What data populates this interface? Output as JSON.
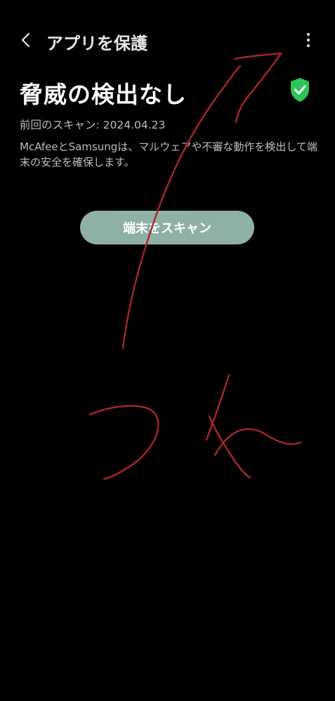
{
  "header": {
    "title": "アプリを保護",
    "back_icon": "chevron-left-icon",
    "more_icon": "more-vertical-icon"
  },
  "status": {
    "title": "脅威の検出なし",
    "icon": "shield-check-icon",
    "icon_color": "#2ec45a",
    "last_scan": "前回のスキャン: 2024.04.23",
    "description": "McAfeeとSamsungは、マルウェアや不審な動作を検出して端末の安全を確保します。"
  },
  "scan_button": {
    "label": "端末をスキャン",
    "color": "#8fb1a4"
  },
  "colors": {
    "background": "#000000",
    "annotation": "#a8262b"
  }
}
